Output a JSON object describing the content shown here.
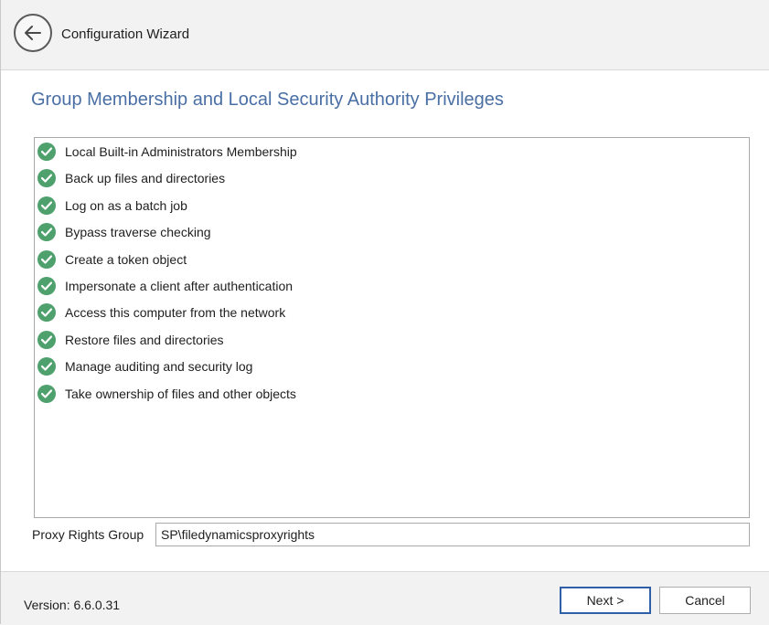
{
  "window": {
    "title": "Configuration Wizard",
    "back_icon": "arrow-left-icon"
  },
  "page": {
    "heading": "Group Membership and Local Security Authority Privileges",
    "check_icon": "check-circle-icon",
    "check_color": "#4ea06c",
    "items": [
      {
        "label": "Local Built-in Administrators Membership",
        "status": "ok"
      },
      {
        "label": "Back up files and directories",
        "status": "ok"
      },
      {
        "label": "Log on as a batch job",
        "status": "ok"
      },
      {
        "label": "Bypass traverse checking",
        "status": "ok"
      },
      {
        "label": "Create a token object",
        "status": "ok"
      },
      {
        "label": "Impersonate a client after authentication",
        "status": "ok"
      },
      {
        "label": "Access this computer from the network",
        "status": "ok"
      },
      {
        "label": "Restore files and directories",
        "status": "ok"
      },
      {
        "label": "Manage auditing and security log",
        "status": "ok"
      },
      {
        "label": "Take ownership of files and other objects",
        "status": "ok"
      }
    ]
  },
  "proxy": {
    "label": "Proxy Rights Group",
    "value": "SP\\filedynamicsproxyrights"
  },
  "footer": {
    "version": "Version: 6.6.0.31",
    "next_label": "Next >",
    "cancel_label": "Cancel"
  },
  "colors": {
    "heading": "#4a6fa5",
    "primary_border": "#2f5fa6"
  }
}
